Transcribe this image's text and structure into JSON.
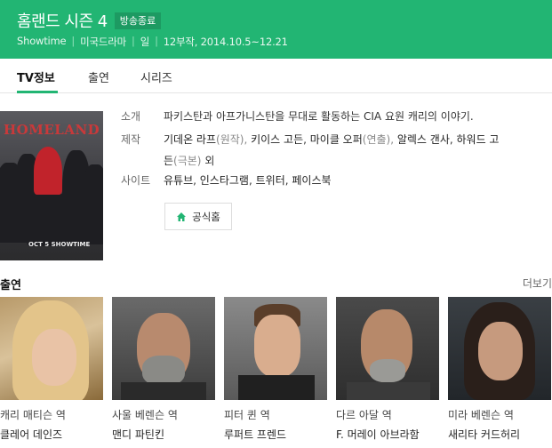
{
  "header": {
    "title": "홈랜드 시즌 4",
    "badge": "방송종료",
    "meta": [
      "Showtime",
      "미국드라마",
      "일",
      "12부작, 2014.10.5~12.21"
    ]
  },
  "tabs": [
    {
      "label": "TV정보",
      "active": true
    },
    {
      "label": "출연",
      "active": false
    },
    {
      "label": "시리즈",
      "active": false
    }
  ],
  "poster": {
    "logo": "HOMELAND",
    "date_text": "OCT 5 SHOWTIME"
  },
  "info": {
    "synopsis_label": "소개",
    "synopsis": "파키스탄과 아프가니스탄을 무대로 활동하는 CIA 요원 캐리의 이야기.",
    "production_label": "제작",
    "production_line1": [
      {
        "text": "기데온 라프",
        "type": "link"
      },
      {
        "text": "(원작), ",
        "type": "role"
      },
      {
        "text": "키이스 고든",
        "type": "link"
      },
      {
        "text": ", ",
        "type": "plain"
      },
      {
        "text": "마이클 오퍼",
        "type": "link"
      },
      {
        "text": "(연출), ",
        "type": "role"
      },
      {
        "text": "알렉스 갠사",
        "type": "link"
      },
      {
        "text": ", ",
        "type": "plain"
      },
      {
        "text": "하워드 고",
        "type": "link"
      }
    ],
    "production_line2": [
      {
        "text": "든",
        "type": "link"
      },
      {
        "text": "(극본)",
        "type": "role"
      },
      {
        "text": " 외",
        "type": "plain"
      }
    ],
    "site_label": "사이트",
    "sites": [
      "유튜브",
      "인스타그램",
      "트위터",
      "페이스북"
    ],
    "home_button": "공식홈"
  },
  "cast": {
    "heading": "출연",
    "more": "더보기",
    "members": [
      {
        "role": "캐리 매티슨 역",
        "name": "클레어 데인즈"
      },
      {
        "role": "사울 베렌슨 역",
        "name": "맨디 파틴킨"
      },
      {
        "role": "피터 퀸 역",
        "name": "루퍼트 프렌드"
      },
      {
        "role": "다르 아달 역",
        "name": "F. 머레이 아브라함"
      },
      {
        "role": "미라 베렌슨 역",
        "name": "새리타 커드허리"
      }
    ]
  },
  "colors": {
    "accent": "#22b573",
    "badge_bg": "#1d9a62"
  }
}
